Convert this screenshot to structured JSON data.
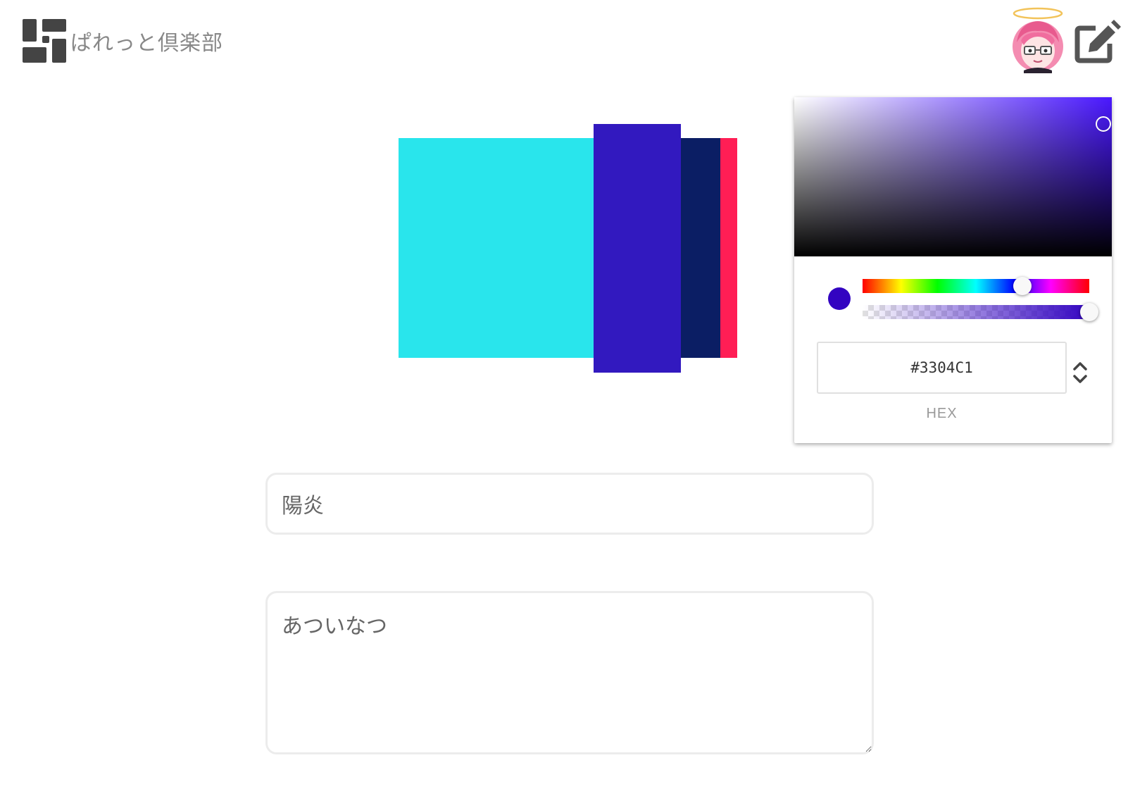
{
  "header": {
    "site_title": "ぱれっと倶楽部",
    "logo_icon": "palette-grid-logo-icon",
    "avatar_icon": "angel-girl-avatar-icon",
    "edit_icon": "edit-pencil-icon"
  },
  "palette": {
    "colors": [
      "#29E5EC",
      "#3219BF",
      "#0B1E64",
      "#FF1E55"
    ]
  },
  "picker": {
    "current_color": "#3304C1",
    "hue_deg": 254,
    "hue_color": "#4A18FF",
    "alpha": 1.0,
    "hex_value": "#3304C1",
    "format_label": "HEX",
    "toggle_icon": "chevron-up-down-icon"
  },
  "form": {
    "name_value": "陽炎",
    "description_value": "あついなつ"
  }
}
